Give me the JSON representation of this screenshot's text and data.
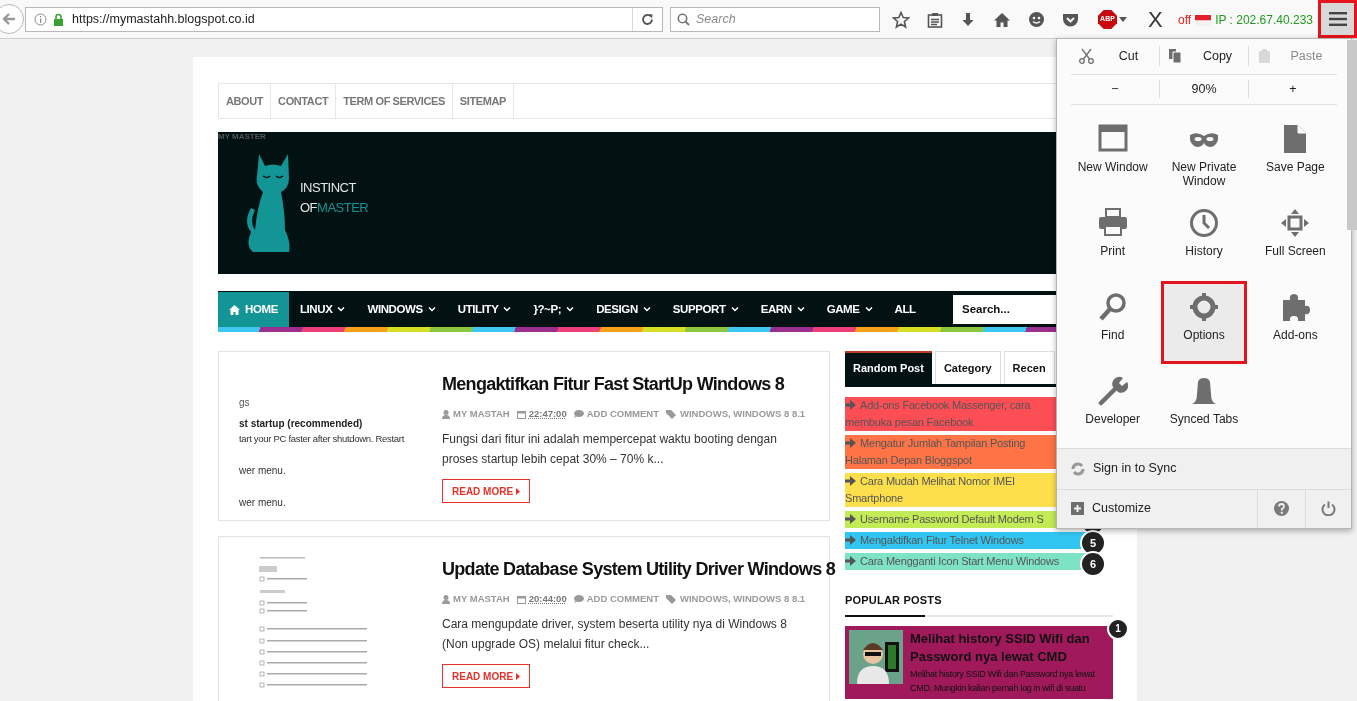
{
  "toolbar": {
    "url": "https://mymastahh.blogspot.co.id",
    "search_placeholder": "Search",
    "abp": "ABP",
    "x_icon": "X",
    "addon_status": "off",
    "ip": "IP : 202.67.40.233",
    "menu_button_highlighted": true
  },
  "top_links": [
    "ABOUT",
    "CONTACT",
    "TERM OF SERVICES",
    "SITEMAP"
  ],
  "banner": {
    "small_label": "MY MASTER",
    "logo_line1": "INSTINCT",
    "logo_of": "OF",
    "logo_master": "MASTER"
  },
  "nav": {
    "items": [
      {
        "label": "HOME",
        "selected": true,
        "dropdown": false
      },
      {
        "label": "LINUX",
        "selected": false,
        "dropdown": true
      },
      {
        "label": "WINDOWS",
        "selected": false,
        "dropdown": true
      },
      {
        "label": "UTILITY",
        "selected": false,
        "dropdown": true
      },
      {
        "label": "}?~P;",
        "selected": false,
        "dropdown": true
      },
      {
        "label": "DESIGN",
        "selected": false,
        "dropdown": true
      },
      {
        "label": "SUPPORT",
        "selected": false,
        "dropdown": true
      },
      {
        "label": "EARN",
        "selected": false,
        "dropdown": true
      },
      {
        "label": "GAME",
        "selected": false,
        "dropdown": true
      },
      {
        "label": "ALL",
        "selected": false,
        "dropdown": false
      }
    ],
    "search_placeholder": "Search..."
  },
  "posts": [
    {
      "title": "Mengaktifkan Fitur Fast StartUp Windows 8",
      "author": "MY MASTAH",
      "time": "22:47:00",
      "comments": "ADD COMMENT",
      "tags": "WINDOWS, WINDOWS 8 8.1",
      "excerpt": "Fungsi dari fitur ini adalah mempercepat waktu booting dengan proses startup lebih cepat 30% – 70% k...",
      "read_more": "READ MORE",
      "thumbnail": {
        "kind": "settings",
        "lines": [
          "gs",
          "st startup (recommended)",
          "tart your PC faster after shutdown. Restart",
          "wer menu.",
          "wer menu."
        ]
      }
    },
    {
      "title": "Update Database System Utility Driver Windows 8",
      "author": "MY MASTAH",
      "time": "20:44:00",
      "comments": "ADD COMMENT",
      "tags": "WINDOWS, WINDOWS 8 8.1",
      "excerpt": "Cara mengupdate driver, system beserta utility nya di Windows 8 (Non upgrade OS) melalui fitur check...",
      "read_more": "READ MORE",
      "thumbnail": {
        "kind": "update_list"
      }
    }
  ],
  "sidebar": {
    "tabs": [
      {
        "label": "Random Post",
        "selected": true
      },
      {
        "label": "Category",
        "selected": false
      },
      {
        "label": "Recen",
        "selected": false
      }
    ],
    "random_posts": [
      {
        "text": "Add-ons Facebook Massenger, cara\nmembuka pesan Facebook",
        "color": "#fd4e56",
        "badge": false
      },
      {
        "text": "Mengatur Jumlah Tampilan Posting\nHalaman Depan Bloggspot",
        "color": "#fe7446",
        "badge": false
      },
      {
        "text": "Cara Mudah Melihat Nomor IMEI\nSmartphone",
        "color": "#fddf4c",
        "badge": false
      },
      {
        "text": "Username Password Default Modem S",
        "color": "#c3eb55",
        "badge": true
      },
      {
        "text": "Mengaktifkan Fitur Telnet Windows",
        "color": "#31c6f2",
        "badge": true,
        "number": "5"
      },
      {
        "text": "Cara Mengganti Icon Start Menu Windows",
        "color": "#7ee2c5",
        "badge": true,
        "number": "6"
      }
    ],
    "popular_heading": "POPULAR POSTS",
    "popular_posts": [
      {
        "title": "Melihat history SSID Wifi dan Password nya lewat CMD",
        "excerpt": "Melihat history SSID Wifi dan Password nya lewat CMD. Mungkin kalian pernah log in wifi di suatu",
        "number": "1"
      }
    ]
  },
  "menu": {
    "edit_row": [
      {
        "label": "Cut",
        "disabled": false
      },
      {
        "label": "Copy",
        "disabled": false
      },
      {
        "label": "Paste",
        "disabled": true
      }
    ],
    "zoom_row": [
      "−",
      "90%",
      "+"
    ],
    "items": [
      {
        "label": "New Window",
        "highlighted": false
      },
      {
        "label": "New Private Window",
        "highlighted": false
      },
      {
        "label": "Save Page",
        "highlighted": false
      },
      {
        "label": "Print",
        "highlighted": false
      },
      {
        "label": "History",
        "highlighted": false
      },
      {
        "label": "Full Screen",
        "highlighted": false
      },
      {
        "label": "Find",
        "highlighted": false
      },
      {
        "label": "Options",
        "highlighted": true
      },
      {
        "label": "Add-ons",
        "highlighted": false
      },
      {
        "label": "Developer",
        "highlighted": false
      },
      {
        "label": "Synced Tabs",
        "highlighted": false
      }
    ],
    "sign_in": "Sign in to Sync",
    "customize": "Customize"
  }
}
